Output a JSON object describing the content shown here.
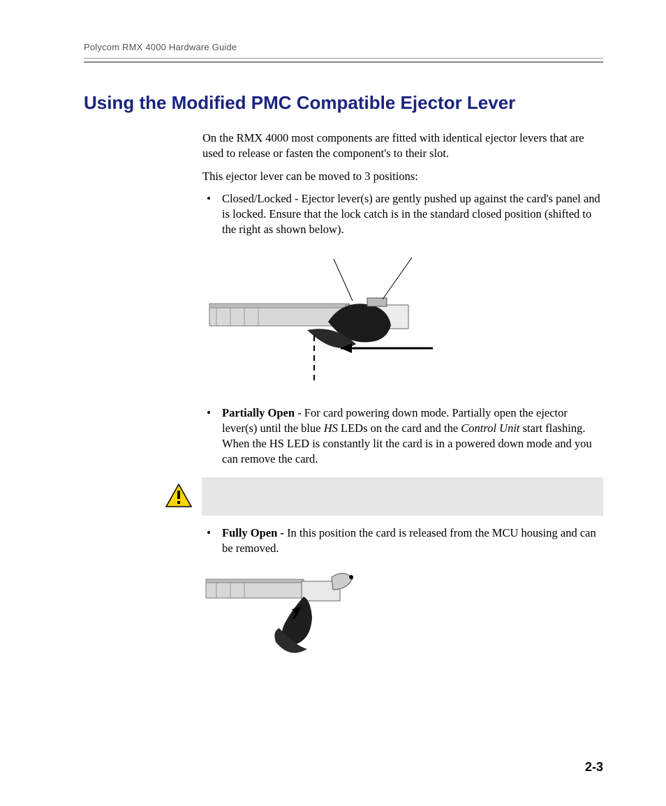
{
  "header": {
    "running_head": "Polycom RMX 4000 Hardware Guide"
  },
  "section": {
    "title": "Using the Modified PMC Compatible Ejector Lever",
    "intro_p1": "On the RMX 4000 most components are fitted with identical ejector levers that are used to release or fasten the component's to their slot.",
    "intro_p2": "This ejector lever can be moved to 3 positions:",
    "bullets": {
      "closed": "Closed/Locked - Ejector lever(s) are gently pushed up against the card's panel and is locked. Ensure that the lock catch is in the standard closed position (shifted to the right as shown below).",
      "partial_label": "Partially Open",
      "partial_rest_a": " - For card powering down mode. Partially open the ejector lever(s) until the blue ",
      "partial_hs": "HS",
      "partial_rest_b": " LEDs on the card and the ",
      "partial_cu": "Control Unit",
      "partial_rest_c": " start flashing. When the HS LED is constantly lit the card is in a powered down mode and you can remove the card.",
      "fully_label": "Fully Open - ",
      "fully_rest": "In this position the card is released from the MCU housing and can be removed."
    }
  },
  "page_number": "2-3"
}
